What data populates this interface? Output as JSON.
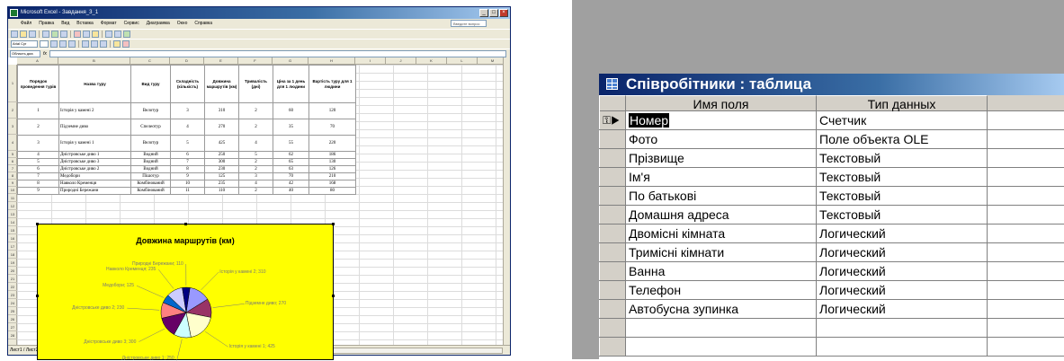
{
  "excel": {
    "title": "Microsoft Excel - Завдання_3_1",
    "menu": [
      "Файл",
      "Правка",
      "Вид",
      "Вставка",
      "Формат",
      "Сервис",
      "Диаграмма",
      "Окно",
      "Справка"
    ],
    "help_placeholder": "Введите вопрос",
    "font_name": "Arial Cyr",
    "cell_ref": "Область диа",
    "formula_label": "fx",
    "columns": [
      "A",
      "B",
      "C",
      "D",
      "E",
      "F",
      "G",
      "H",
      "I",
      "J",
      "K",
      "L",
      "M",
      "N"
    ],
    "headers": [
      "Порядок проведення турів",
      "Назва туру",
      "Вид туру",
      "Складність (кількість)",
      "Довжина маршрутів (км)",
      "Тривалість (дні)",
      "Ціна за 1 день для 1 людини",
      "Вартість туру для 1 людини"
    ],
    "rows": [
      [
        "1",
        "Історія у камені 2",
        "Велотур",
        "3",
        "310",
        "2",
        "60",
        "120"
      ],
      [
        "2",
        "Підземне диво",
        "Спелеотур",
        "4",
        "270",
        "2",
        "35",
        "70"
      ],
      [
        "3",
        "Історія у камені 1",
        "Велотур",
        "5",
        "425",
        "4",
        "55",
        "220"
      ],
      [
        "4",
        "Дністровське диво 1",
        "Водний",
        "6",
        "250",
        "5",
        "62",
        "186"
      ],
      [
        "5",
        "Дністровське диво 3",
        "Водний",
        "7",
        "300",
        "2",
        "65",
        "130"
      ],
      [
        "6",
        "Дністровське диво 2",
        "Водний",
        "8",
        "230",
        "2",
        "63",
        "126"
      ],
      [
        "7",
        "Медобори",
        "Пішотур",
        "9",
        "125",
        "3",
        "70",
        "210"
      ],
      [
        "8",
        "Навколо Кременця",
        "Комбінований",
        "10",
        "235",
        "4",
        "42",
        "168"
      ],
      [
        "9",
        "Природні Бережани",
        "Комбінований",
        "11",
        "110",
        "2",
        "40",
        "80"
      ]
    ],
    "row_numbers": [
      "1",
      "2",
      "3",
      "4",
      "5",
      "6",
      "7",
      "8",
      "9",
      "10",
      "11",
      "12",
      "13",
      "14",
      "15",
      "16",
      "17",
      "18",
      "19",
      "20",
      "21",
      "22",
      "23",
      "24",
      "25",
      "26",
      "27",
      "28"
    ],
    "sheet_tabs": "Лист1 / Лист2 / Лист3 /"
  },
  "chart_data": {
    "type": "pie",
    "title": "Довжина маршрутів (км)",
    "categories": [
      "Історія у камені 2",
      "Підземне диво",
      "Історія у камені 1",
      "Дністровське диво 1",
      "Дністровське диво 3",
      "Дністровське диво 2",
      "Медобори",
      "Навколо Кременця",
      "Природні Бережани"
    ],
    "values": [
      310,
      270,
      425,
      250,
      300,
      230,
      125,
      235,
      110
    ],
    "labels": [
      "Історія у камені 2; 310",
      "Підземне диво; 270",
      "Історія у камені 1; 425",
      "Дністровське диво 1; 250",
      "Дністровське диво 3; 300",
      "Дністровське диво 2; 230",
      "Медобори; 125",
      "Навколо Кременця; 235",
      "Природні Бережани; 110"
    ],
    "colors": [
      "#9999ff",
      "#993366",
      "#ffffcc",
      "#ccffff",
      "#660066",
      "#ff8080",
      "#0066cc",
      "#ccccff",
      "#000080"
    ],
    "background": "#ffff00"
  },
  "access": {
    "title": "Співробітники : таблица",
    "columns": [
      "Имя поля",
      "Тип данных"
    ],
    "fields": [
      {
        "name": "Номер",
        "type": "Счетчик"
      },
      {
        "name": "Фото",
        "type": "Поле объекта OLE"
      },
      {
        "name": "Прізвище",
        "type": "Текстовый"
      },
      {
        "name": "Ім'я",
        "type": "Текстовый"
      },
      {
        "name": "По батькові",
        "type": "Текстовый"
      },
      {
        "name": "Домашня адреса",
        "type": "Текстовый"
      },
      {
        "name": "Двомісні кімната",
        "type": "Логический"
      },
      {
        "name": "Тримісні кімнати",
        "type": "Логический"
      },
      {
        "name": "Ванна",
        "type": "Логический"
      },
      {
        "name": "Телефон",
        "type": "Логический"
      },
      {
        "name": "Автобусна зупинка",
        "type": "Логический"
      }
    ],
    "key_marker": "⚿▶",
    "colors": {
      "titlebar": "#0a246a",
      "gray_bg": "#a0a0a0"
    }
  }
}
